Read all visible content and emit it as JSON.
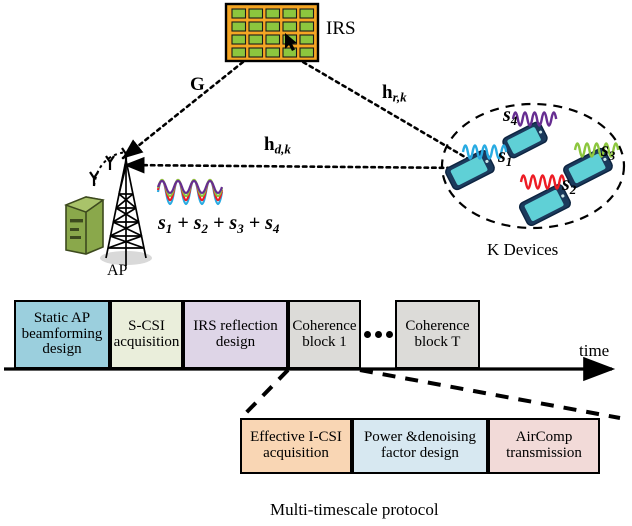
{
  "figure": {
    "caption": "Multi-timescale  protocol"
  },
  "system": {
    "irs_label": "IRS",
    "ap_label": "AP",
    "devices_label": "K Devices",
    "channel_ap_irs": {
      "main": "G",
      "sub": ""
    },
    "channel_irs_device": {
      "main": "h",
      "sub": "r,k"
    },
    "channel_direct": {
      "main": "h",
      "sub": "d,k"
    },
    "ap_received_signal": "s₁ + s₂ + s₃ + s₄",
    "ap_signal_parts": [
      "s",
      "1",
      "s",
      "2",
      "s",
      "3",
      "s",
      "4"
    ],
    "devices": [
      {
        "id": "s1",
        "label": "s",
        "sub": "1",
        "color": "#29abe2"
      },
      {
        "id": "s2",
        "label": "s",
        "sub": "2",
        "color": "#ed1c24"
      },
      {
        "id": "s3",
        "label": "s",
        "sub": "3",
        "color": "#8cc63e"
      },
      {
        "id": "s4",
        "label": "s",
        "sub": "4",
        "color": "#662d91"
      }
    ],
    "irs_grid": {
      "cols": 5,
      "rows": 4,
      "cell_color": "#8cc63e",
      "panel_color": "#f5a623"
    }
  },
  "timeline": {
    "axis_label": "time",
    "ellipsis": "•••",
    "blocks": [
      {
        "id": "static-ap-beamforming",
        "lines": [
          "Static AP",
          "beamforming",
          "design"
        ],
        "color": "#9bcfdd"
      },
      {
        "id": "s-csi-acquisition",
        "lines": [
          "S-CSI",
          "acquisition"
        ],
        "color": "#eaeedb"
      },
      {
        "id": "irs-reflection-design",
        "lines": [
          "IRS reflection",
          "design"
        ],
        "color": "#ded5e7"
      },
      {
        "id": "coherence-block-1",
        "lines": [
          "Coherence",
          "block  1"
        ],
        "color": "#dcdbd8"
      },
      {
        "id": "coherence-block-t",
        "lines": [
          "Coherence",
          "block T"
        ],
        "color": "#dcdbd8"
      }
    ]
  },
  "protocol": {
    "blocks": [
      {
        "id": "effective-icsi-acquisition",
        "lines": [
          "Effective I-CSI",
          "acquisition"
        ],
        "color": "#f9d6b4"
      },
      {
        "id": "power-denoising-factor-design",
        "lines": [
          "Power &denoising",
          "factor design"
        ],
        "color": "#d7e8f1"
      },
      {
        "id": "aircomp-transmission",
        "lines": [
          "AirComp",
          "transmission"
        ],
        "color": "#f2dad8"
      }
    ]
  }
}
